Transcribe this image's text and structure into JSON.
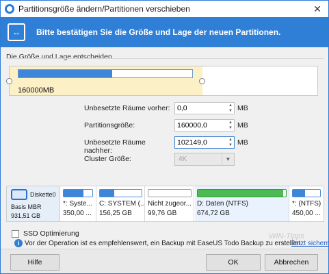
{
  "window": {
    "title": "Partitionsgröße ändern/Partitionen verschieben",
    "close_glyph": "✕"
  },
  "banner": {
    "icon_glyph": "↔",
    "text": "Bitte bestätigen Sie die Größe und Lage der neuen Partitionen."
  },
  "editor": {
    "group_label": "Die Größe und Lage entscheiden",
    "partition_size_label": "160000MB",
    "fill_fraction": 0.54
  },
  "form": {
    "before": {
      "label": "Unbesetzte Räume vorher:",
      "value": "0,0",
      "unit": "MB"
    },
    "size": {
      "label": "Partitionsgröße:",
      "value": "160000,0",
      "unit": "MB"
    },
    "after": {
      "label": "Unbesetzte Räume nachher:",
      "value": "102149,0",
      "unit": "MB"
    },
    "cluster": {
      "label": "Cluster Größe:",
      "value": "4K"
    }
  },
  "diskmap": {
    "disk_name": "Diskette0",
    "disk_type": "Basis MBR",
    "disk_capacity": "931,51 GB",
    "partitions": [
      {
        "label": "*: Syste...",
        "size": "350,00 ...",
        "fill": 0.7,
        "style": "blue"
      },
      {
        "label": "C: SYSTEM (...",
        "size": "156,25 GB",
        "fill": 0.35,
        "style": "blue"
      },
      {
        "label": "Nicht zugeor...",
        "size": "99,76 GB",
        "fill": 0,
        "style": "gray"
      },
      {
        "label": "D: Daten (NTFS)",
        "size": "674,72 GB",
        "fill": 0.97,
        "style": "green"
      },
      {
        "label": "*: (NTFS)",
        "size": "450,00 ...",
        "fill": 0.45,
        "style": "blue"
      }
    ]
  },
  "ssd": {
    "label": "SSD Optimierung"
  },
  "info": {
    "icon_glyph": "i",
    "text": "Vor der Operation ist es empfehlenswert, ein Backup mit  EaseUS Todo Backup zu erstellen.",
    "link": "Jetzt sichern"
  },
  "watermark": "WIN-Tipps",
  "buttons": {
    "help": "Hilfe",
    "ok": "OK",
    "cancel": "Abbrechen"
  },
  "colors": {
    "accent": "#2f7fd6",
    "partition_blue": "#3d86d9",
    "partition_green": "#4dbb54",
    "highlight": "#fbf0c6"
  }
}
